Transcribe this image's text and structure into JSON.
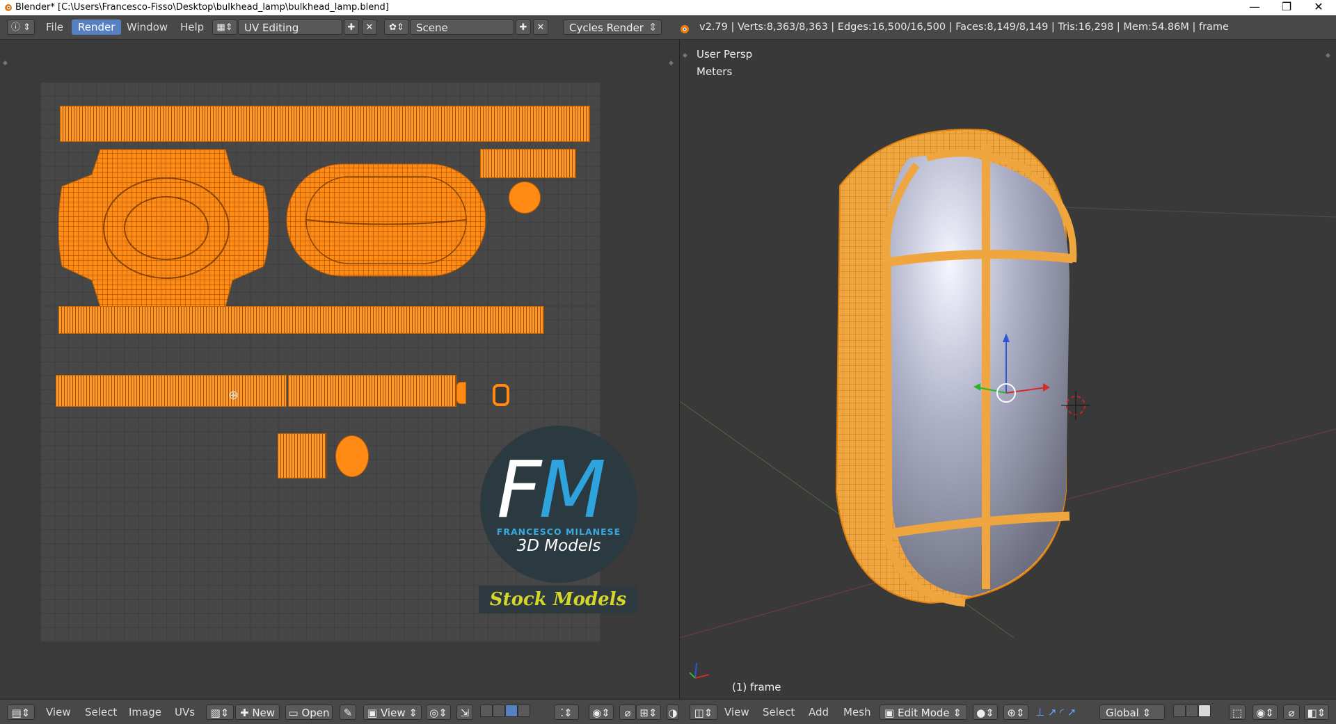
{
  "window": {
    "title": "Blender* [C:\\Users\\Francesco-Fisso\\Desktop\\bulkhead_lamp\\bulkhead_lamp.blend]",
    "controls": [
      "—",
      "❐",
      "✕"
    ]
  },
  "header": {
    "menus": [
      "File",
      "Render",
      "Window",
      "Help"
    ],
    "active_menu": "Render",
    "screen_layout": "UV Editing",
    "scene": "Scene",
    "render_engine": "Cycles Render",
    "stats": "v2.79 | Verts:8,363/8,363 | Edges:16,500/16,500 | Faces:8,149/8,149 | Tris:16,298 | Mem:54.86M | frame"
  },
  "viewport": {
    "view_name": "User Persp",
    "units": "Meters",
    "object_label": "(1) frame"
  },
  "watermark": {
    "logo_letters_f": "F",
    "logo_letters_m": "M",
    "author": "FRANCESCO MILANESE",
    "tagline": "3D Models",
    "banner": "Stock Models"
  },
  "uv_footer": {
    "menus": [
      "View",
      "Select",
      "Image",
      "UVs"
    ],
    "new_label": "New",
    "open_label": "Open",
    "view_label": "View"
  },
  "view3d_footer": {
    "menus": [
      "View",
      "Select",
      "Add",
      "Mesh"
    ],
    "mode": "Edit Mode",
    "orientation": "Global"
  },
  "colors": {
    "accent": "#5680c2",
    "selection": "#ff8a14",
    "background": "#393939"
  }
}
